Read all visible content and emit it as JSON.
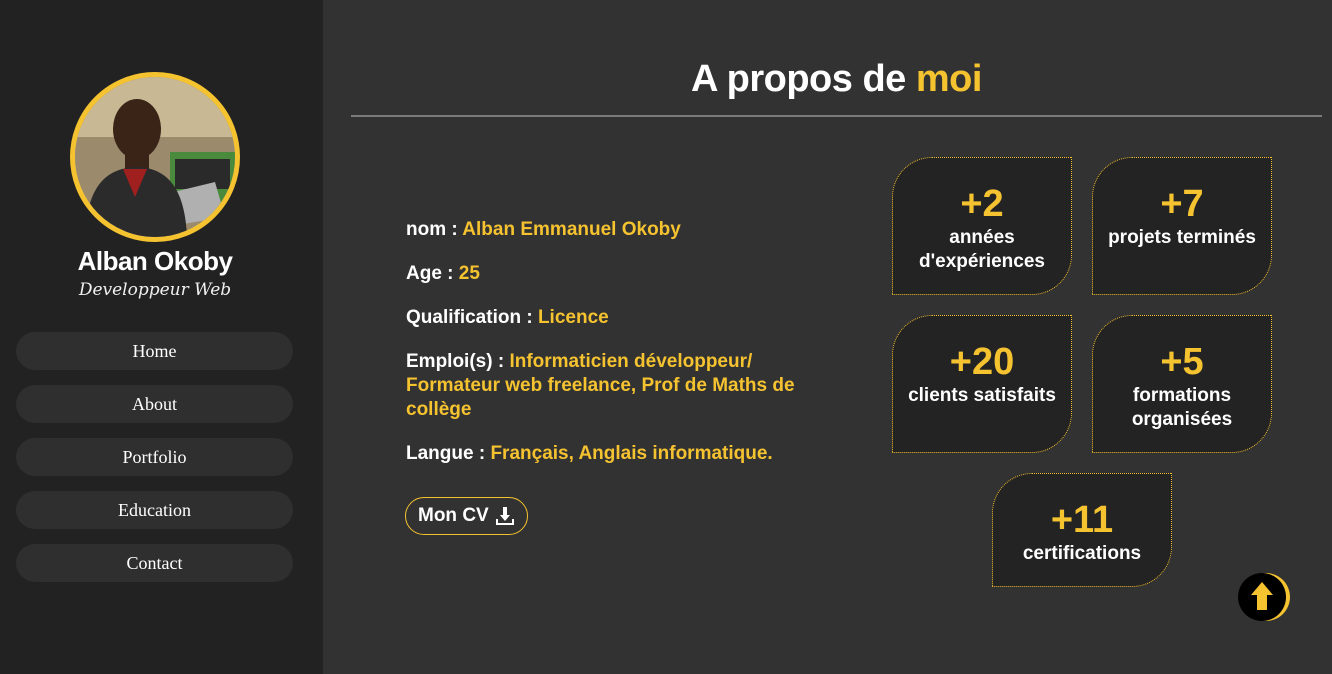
{
  "sidebar": {
    "name": "Alban Okoby",
    "role": "Developpeur Web",
    "nav": [
      "Home",
      "About",
      "Portfolio",
      "Education",
      "Contact"
    ]
  },
  "main": {
    "title_part1": "A propos de ",
    "title_accent": "moi",
    "info": [
      {
        "label": "nom : ",
        "value": "Alban Emmanuel Okoby"
      },
      {
        "label": "Age : ",
        "value": "25"
      },
      {
        "label": "Qualification : ",
        "value": "Licence"
      },
      {
        "label": "Emploi(s) : ",
        "value": "Informaticien développeur/ Formateur web freelance, Prof de Maths de collège"
      },
      {
        "label": "Langue : ",
        "value": "Français, Anglais informatique."
      }
    ],
    "cv_button": "Mon CV",
    "stats": [
      {
        "number": "+2",
        "label": "années d'expériences"
      },
      {
        "number": "+7",
        "label": "projets terminés"
      },
      {
        "number": "+20",
        "label": "clients satisfaits"
      },
      {
        "number": "+5",
        "label": "formations organisées"
      },
      {
        "number": "+11",
        "label": "certifications"
      }
    ]
  },
  "colors": {
    "accent": "#f5c230",
    "sidebar_bg": "#222222",
    "main_bg": "#323232"
  },
  "icons": {
    "cv": "download-icon",
    "scroll": "arrow-up-icon"
  }
}
